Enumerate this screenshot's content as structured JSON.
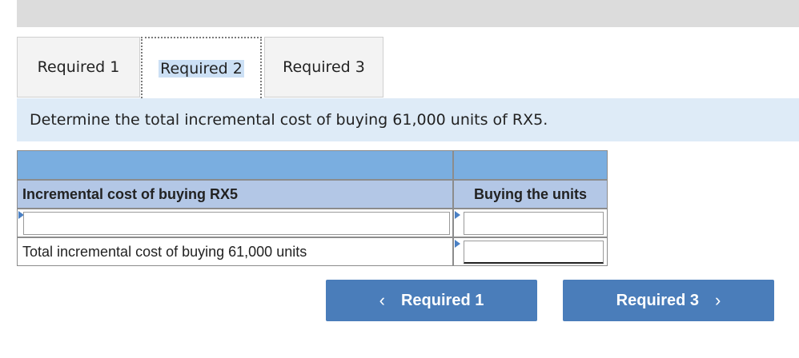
{
  "tabs": [
    {
      "label": "Required 1"
    },
    {
      "label": "Required 2"
    },
    {
      "label": "Required 3"
    }
  ],
  "prompt": "Determine the total incremental cost of buying 61,000 units of RX5.",
  "table": {
    "header_left": "Incremental cost of buying RX5",
    "header_right": "Buying the units",
    "rows": [
      {
        "label": "",
        "value": ""
      },
      {
        "label": "Total incremental cost of buying 61,000 units",
        "value": ""
      }
    ]
  },
  "nav": {
    "prev_label": "Required 1",
    "next_label": "Required 3",
    "prev_icon": "chevron-left-icon",
    "next_icon": "chevron-right-icon"
  },
  "colors": {
    "button": "#4a7dba",
    "table_header_top": "#7aaee0",
    "table_header": "#b3c7e6",
    "prompt_background": "#deebf7"
  }
}
